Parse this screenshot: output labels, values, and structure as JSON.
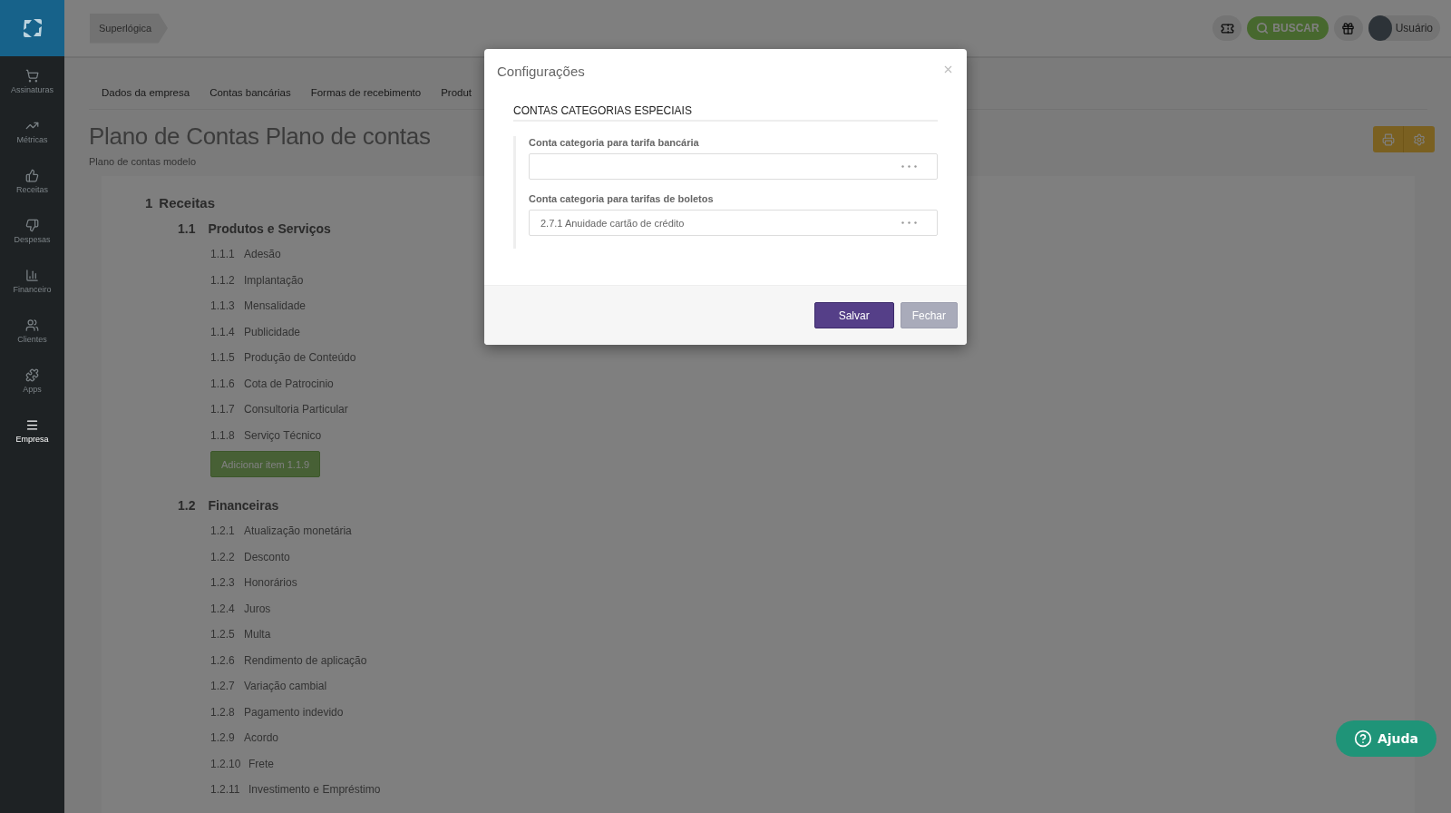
{
  "sidebar": {
    "items": [
      {
        "label": "Assinaturas",
        "selected": false
      },
      {
        "label": "Métricas",
        "selected": false
      },
      {
        "label": "Receitas",
        "selected": false
      },
      {
        "label": "Despesas",
        "selected": false
      },
      {
        "label": "Financeiro",
        "selected": false
      },
      {
        "label": "Clientes",
        "selected": false
      },
      {
        "label": "Apps",
        "selected": false
      },
      {
        "label": "Empresa",
        "selected": true
      }
    ]
  },
  "breadcrumb": "Superlógica",
  "topbar": {
    "search_button": "BUSCAR",
    "user": "Usuário"
  },
  "tabs": [
    "Dados da empresa",
    "Contas bancárias",
    "Formas de recebimento",
    "Produt"
  ],
  "page": {
    "title": "Plano de Contas Plano de contas",
    "subtitle": "Plano de contas modelo"
  },
  "tree": [
    {
      "code": "1",
      "label": "Receitas",
      "children": [
        {
          "code": "1.1",
          "label": "Produtos e Serviços",
          "add_button": "Adicionar item 1.1.9",
          "children": [
            {
              "code": "1.1.1",
              "label": "Adesão"
            },
            {
              "code": "1.1.2",
              "label": "Implantação"
            },
            {
              "code": "1.1.3",
              "label": "Mensalidade"
            },
            {
              "code": "1.1.4",
              "label": "Publicidade"
            },
            {
              "code": "1.1.5",
              "label": "Produção de Conteúdo"
            },
            {
              "code": "1.1.6",
              "label": "Cota de Patrocinio"
            },
            {
              "code": "1.1.7",
              "label": "Consultoria Particular"
            },
            {
              "code": "1.1.8",
              "label": "Serviço Técnico"
            }
          ]
        },
        {
          "code": "1.2",
          "label": "Financeiras",
          "children": [
            {
              "code": "1.2.1",
              "label": "Atualização monetária"
            },
            {
              "code": "1.2.2",
              "label": "Desconto"
            },
            {
              "code": "1.2.3",
              "label": "Honorários"
            },
            {
              "code": "1.2.4",
              "label": "Juros"
            },
            {
              "code": "1.2.5",
              "label": "Multa"
            },
            {
              "code": "1.2.6",
              "label": "Rendimento de aplicação"
            },
            {
              "code": "1.2.7",
              "label": "Variação cambial"
            },
            {
              "code": "1.2.8",
              "label": "Pagamento indevido"
            },
            {
              "code": "1.2.9",
              "label": "Acordo"
            },
            {
              "code": "1.2.10",
              "label": "Frete"
            },
            {
              "code": "1.2.11",
              "label": "Investimento e Empréstimo"
            }
          ]
        }
      ]
    }
  ],
  "modal": {
    "title": "Configurações",
    "section": "CONTAS CATEGORIAS ESPECIAIS",
    "fields": [
      {
        "label": "Conta categoria para tarifa bancária"
      },
      {
        "label": "Conta categoria para tarifas de boletos",
        "value": "2.7.1 Anuidade cartão de crédito"
      }
    ],
    "buttons": [
      {
        "label": "Salvar",
        "kind": "primary"
      },
      {
        "label": "Fechar",
        "kind": "muted"
      }
    ]
  },
  "help_button": "Ajuda"
}
